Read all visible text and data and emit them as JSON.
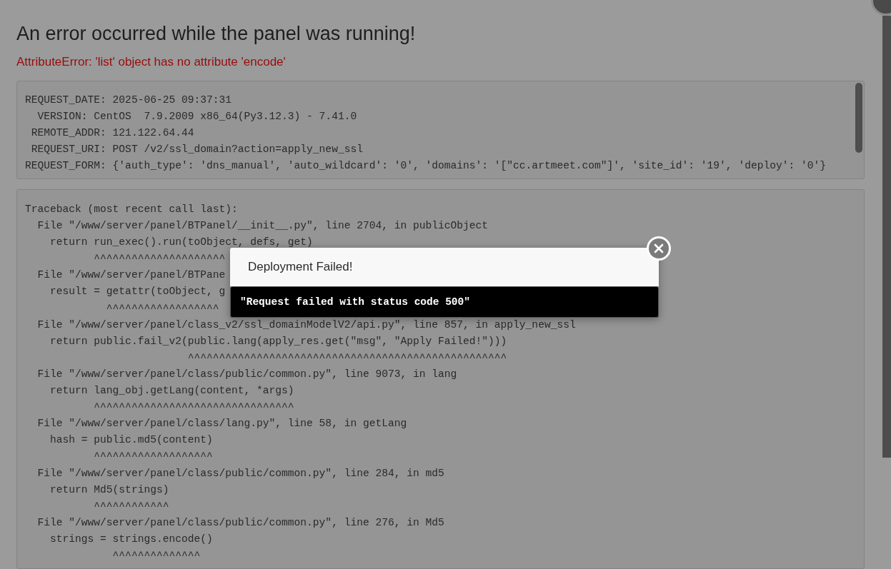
{
  "page": {
    "title": "An error occurred while the panel was running!",
    "error": "AttributeError: 'list' object has no attribute 'encode'"
  },
  "request": {
    "lines": [
      "REQUEST_DATE: 2025-06-25 09:37:31",
      "  VERSION: CentOS  7.9.2009 x86_64(Py3.12.3) - 7.41.0",
      " REMOTE_ADDR: 121.122.64.44",
      " REQUEST_URI: POST /v2/ssl_domain?action=apply_new_ssl",
      "REQUEST_FORM: {'auth_type': 'dns_manual', 'auto_wildcard': '0', 'domains': '[\"cc.artmeet.com\"]', 'site_id': '19', 'deploy': '0'}"
    ]
  },
  "traceback": {
    "lines": [
      "Traceback (most recent call last):",
      "  File \"/www/server/panel/BTPanel/__init__.py\", line 2704, in publicObject",
      "    return run_exec().run(toObject, defs, get)",
      "           ^^^^^^^^^^^^^^^^^^^^^",
      "  File \"/www/server/panel/BTPane",
      "    result = getattr(toObject, g",
      "             ^^^^^^^^^^^^^^^^^^",
      "  File \"/www/server/panel/class_v2/ssl_domainModelV2/api.py\", line 857, in apply_new_ssl",
      "    return public.fail_v2(public.lang(apply_res.get(\"msg\", \"Apply Failed!\")))",
      "                          ^^^^^^^^^^^^^^^^^^^^^^^^^^^^^^^^^^^^^^^^^^^^^^^^^^^",
      "  File \"/www/server/panel/class/public/common.py\", line 9073, in lang",
      "    return lang_obj.getLang(content, *args)",
      "           ^^^^^^^^^^^^^^^^^^^^^^^^^^^^^^^^",
      "  File \"/www/server/panel/class/lang.py\", line 58, in getLang",
      "    hash = public.md5(content)",
      "           ^^^^^^^^^^^^^^^^^^^",
      "  File \"/www/server/panel/class/public/common.py\", line 284, in md5",
      "    return Md5(strings)",
      "           ^^^^^^^^^^^^",
      "  File \"/www/server/panel/class/public/common.py\", line 276, in Md5",
      "    strings = strings.encode()",
      "              ^^^^^^^^^^^^^^"
    ]
  },
  "dialog": {
    "title": "Deployment Failed!",
    "message": "\"Request failed with status code 500\""
  }
}
